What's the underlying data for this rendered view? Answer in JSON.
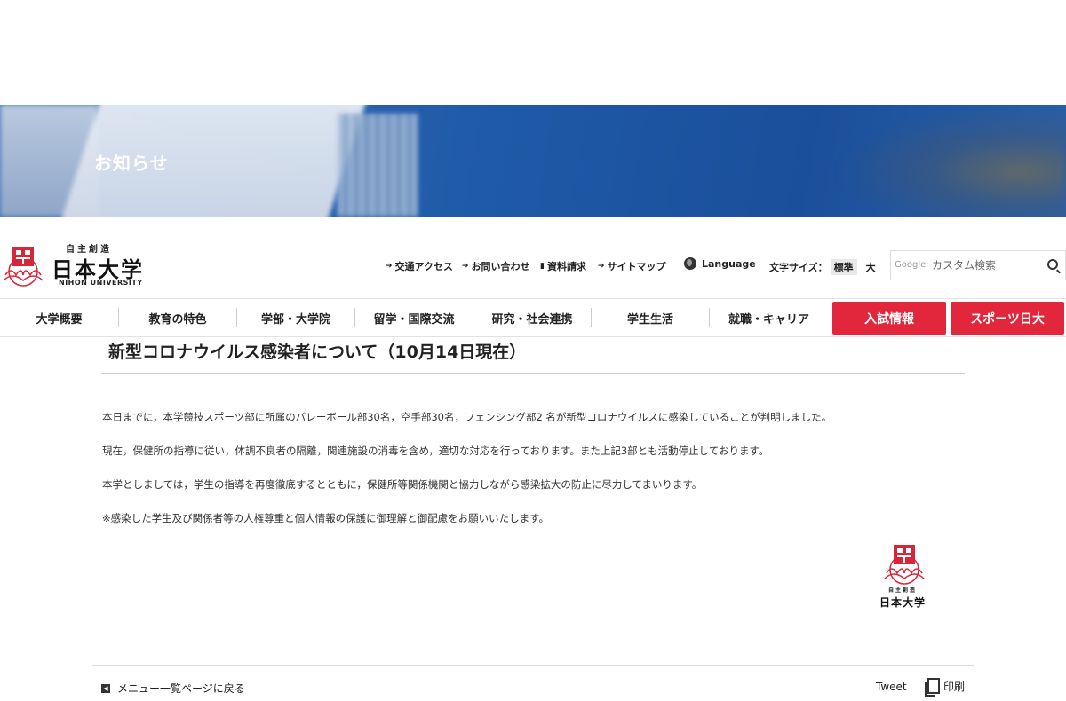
{
  "hero": {
    "title": "お知らせ"
  },
  "logo": {
    "sub": "自主創造",
    "main": "日本大学",
    "en": "NIHON UNIVERSITY"
  },
  "utility": {
    "access": "交通アクセス",
    "contact": "お問い合わせ",
    "docs": "資料請求",
    "sitemap": "サイトマップ",
    "language": "Language",
    "fontsize_label": "文字サイズ：",
    "fontsize_standard": "標準",
    "fontsize_large": "大"
  },
  "search": {
    "brand": "Google",
    "placeholder": "カスタム検索"
  },
  "nav": {
    "items": [
      "大学概要",
      "教育の特色",
      "学部・大学院",
      "留学・国際交流",
      "研究・社会連携",
      "学生生活",
      "就職・キャリア"
    ],
    "admissions": "入試情報",
    "sports": "スポーツ日大"
  },
  "article": {
    "title": "新型コロナウイルス感染者について（10月14日現在）",
    "paragraphs": [
      "本日までに，本学競技スポーツ部に所属のバレーボール部30名，空手部30名，フェンシング部2 名が新型コロナウイルスに感染していることが判明しました。",
      "現在，保健所の指導に従い，体調不良者の隔離，関連施設の消毒を含め，適切な対応を行っております。また上記3部とも活動停止しております。",
      "本学としましては，学生の指導を再度徹底するとともに，保健所等関係機関と協力しながら感染拡大の防止に尽力してまいります。",
      "※感染した学生及び関係者等の人権尊重と個人情報の保護に御理解と御配慮をお願いいたします。"
    ],
    "seal_sub": "自主創造",
    "seal_main": "日本大学"
  },
  "footer": {
    "back": "メニュー一覧ページに戻る",
    "tweet": "Tweet",
    "print": "印刷"
  },
  "colors": {
    "accent_red": "#e2273c",
    "hero_blue": "#1f5aa8"
  }
}
